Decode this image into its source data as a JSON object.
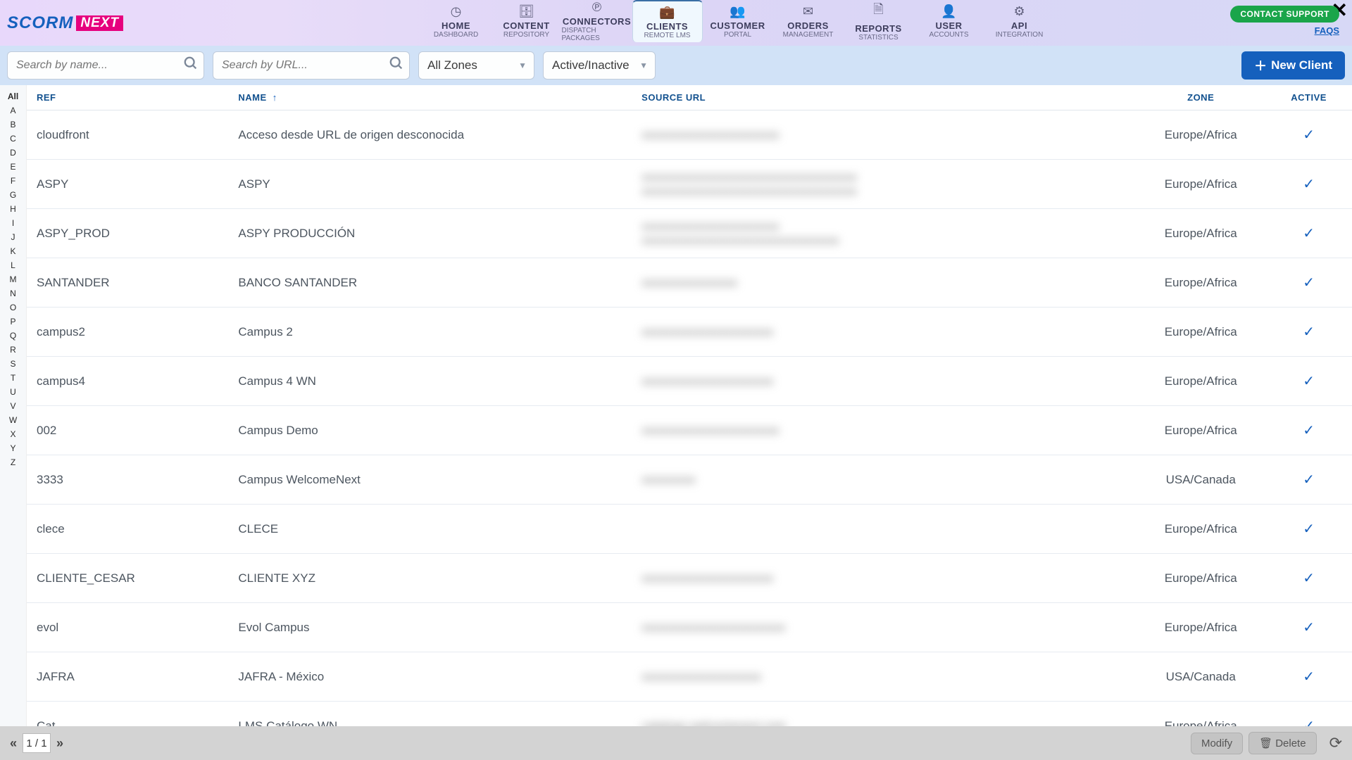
{
  "brand": {
    "scorm": "SCORM",
    "next": "NEXT"
  },
  "nav": [
    {
      "label": "HOME",
      "sub": "DASHBOARD",
      "icon": "◷"
    },
    {
      "label": "CONTENT",
      "sub": "REPOSITORY",
      "icon": "🗄"
    },
    {
      "label": "CONNECTORS",
      "sub": "DISPATCH PACKAGES",
      "icon": "℗"
    },
    {
      "label": "CLIENTS",
      "sub": "REMOTE LMS",
      "icon": "💼",
      "active": true
    },
    {
      "label": "CUSTOMER",
      "sub": "PORTAL",
      "icon": "👥"
    },
    {
      "label": "ORDERS",
      "sub": "MANAGEMENT",
      "icon": "✉"
    },
    {
      "label": "REPORTS",
      "sub": "STATISTICS",
      "icon": "🗎"
    },
    {
      "label": "USER",
      "sub": "ACCOUNTS",
      "icon": "👤"
    },
    {
      "label": "API",
      "sub": "INTEGRATION",
      "icon": "⚙"
    }
  ],
  "top_right": {
    "support": "CONTACT SUPPORT",
    "faqs": "FAQS"
  },
  "filters": {
    "search_name_placeholder": "Search by name...",
    "search_url_placeholder": "Search by URL...",
    "zone_selected": "All Zones",
    "status_selected": "Active/Inactive",
    "new_client": "New Client"
  },
  "alpha": [
    "All",
    "A",
    "B",
    "C",
    "D",
    "E",
    "F",
    "G",
    "H",
    "I",
    "J",
    "K",
    "L",
    "M",
    "N",
    "O",
    "P",
    "Q",
    "R",
    "S",
    "T",
    "U",
    "V",
    "W",
    "X",
    "Y",
    "Z"
  ],
  "columns": {
    "ref": "REF",
    "name": "NAME",
    "url": "SOURCE URL",
    "zone": "ZONE",
    "active": "ACTIVE"
  },
  "rows": [
    {
      "ref": "cloudfront",
      "name": "Acceso desde URL de origen desconocida",
      "url": "xxxxxxxxxxxxxxxxxxxxxxx",
      "zone": "Europe/Africa",
      "active": true
    },
    {
      "ref": "ASPY",
      "name": "ASPY",
      "url": "xxxxxxxxxxxxxxxxxxxxxxxxxxxxxxxxxxxx\nxxxxxxxxxxxxxxxxxxxxxxxxxxxxxxxxxxxx",
      "zone": "Europe/Africa",
      "active": true
    },
    {
      "ref": "ASPY_PROD",
      "name": "ASPY PRODUCCIÓN",
      "url": "xxxxxxxxxxxxxxxxxxxxxxx\nxxxxxxxxxxxxxxxxxxxxxxxxxxxxxxxxx",
      "zone": "Europe/Africa",
      "active": true
    },
    {
      "ref": "SANTANDER",
      "name": "BANCO SANTANDER",
      "url": "xxxxxxxxxxxxxxxx",
      "zone": "Europe/Africa",
      "active": true
    },
    {
      "ref": "campus2",
      "name": "Campus 2",
      "url": "xxxxxxxxxxxxxxxxxxxxxx",
      "zone": "Europe/Africa",
      "active": true
    },
    {
      "ref": "campus4",
      "name": "Campus 4 WN",
      "url": "xxxxxxxxxxxxxxxxxxxxxx",
      "zone": "Europe/Africa",
      "active": true
    },
    {
      "ref": "002",
      "name": "Campus Demo",
      "url": "xxxxxxxxxxxxxxxxxxxxxxx",
      "zone": "Europe/Africa",
      "active": true
    },
    {
      "ref": "3333",
      "name": "Campus WelcomeNext",
      "url": "xxxxxxxxx",
      "zone": "USA/Canada",
      "active": true
    },
    {
      "ref": "clece",
      "name": "CLECE",
      "url": "",
      "zone": "Europe/Africa",
      "active": true
    },
    {
      "ref": "CLIENTE_CESAR",
      "name": "CLIENTE XYZ",
      "url": "xxxxxxxxxxxxxxxxxxxxxx",
      "zone": "Europe/Africa",
      "active": true
    },
    {
      "ref": "evol",
      "name": "Evol Campus",
      "url": "xxxxxxxxxxxxxxxxxxxxxxxx",
      "zone": "Europe/Africa",
      "active": true
    },
    {
      "ref": "JAFRA",
      "name": "JAFRA - México",
      "url": "xxxxxxxxxxxxxxxxxxxx",
      "zone": "USA/Canada",
      "active": true
    },
    {
      "ref": "Cat",
      "name": "LMS Catálogo WN",
      "url": "catalogo.welcomenext.com",
      "zone": "Europe/Africa",
      "active": true
    }
  ],
  "footer": {
    "page": "1 / 1",
    "modify": "Modify",
    "delete": "Delete"
  }
}
